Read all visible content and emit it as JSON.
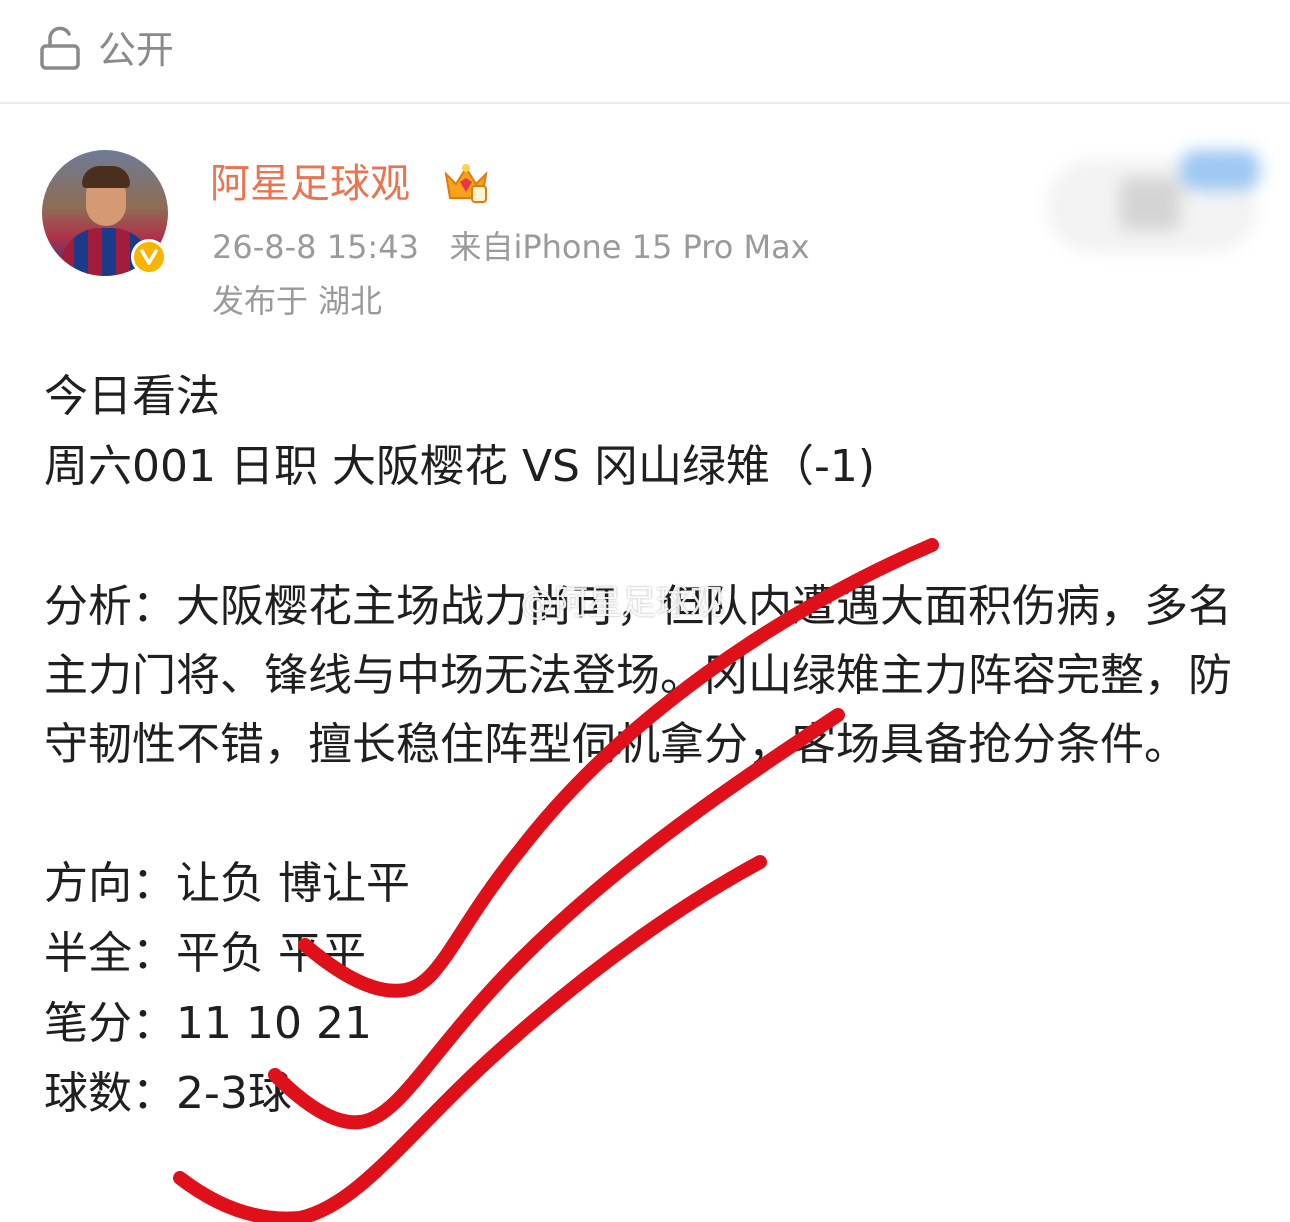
{
  "header": {
    "visibility_label": "公开",
    "icon": "lock-icon"
  },
  "author": {
    "name": "阿星足球观",
    "timestamp": "26-8-8 15:43",
    "source": "来自iPhone 15 Pro Max",
    "location": "发布于 湖北",
    "badge": "verified-badge",
    "name_color": "#eb7350"
  },
  "post": {
    "intro_title": "今日看法",
    "match_line": "周六001 日职 大阪樱花 VS 冈山绿雉（-1)",
    "analysis": "分析：大阪樱花主场战力尚可，但队内遭遇大面积伤病，多名主力门将、锋线与中场无法登场。冈山绿雉主力阵容完整，防守韧性不错，擅长稳住阵型伺机拿分，客场具备抢分条件。",
    "details": [
      {
        "label": "方向：",
        "value": "让负 博让平"
      },
      {
        "label": "半全：",
        "value": "平负 平平"
      },
      {
        "label": "笔分：",
        "value": "11 10 21"
      },
      {
        "label": "球数：",
        "value": "2-3球"
      }
    ]
  },
  "watermark": "@阿星足球观",
  "colors": {
    "stroke_red": "#e0101a",
    "meta_grey": "#9a9a9a"
  }
}
